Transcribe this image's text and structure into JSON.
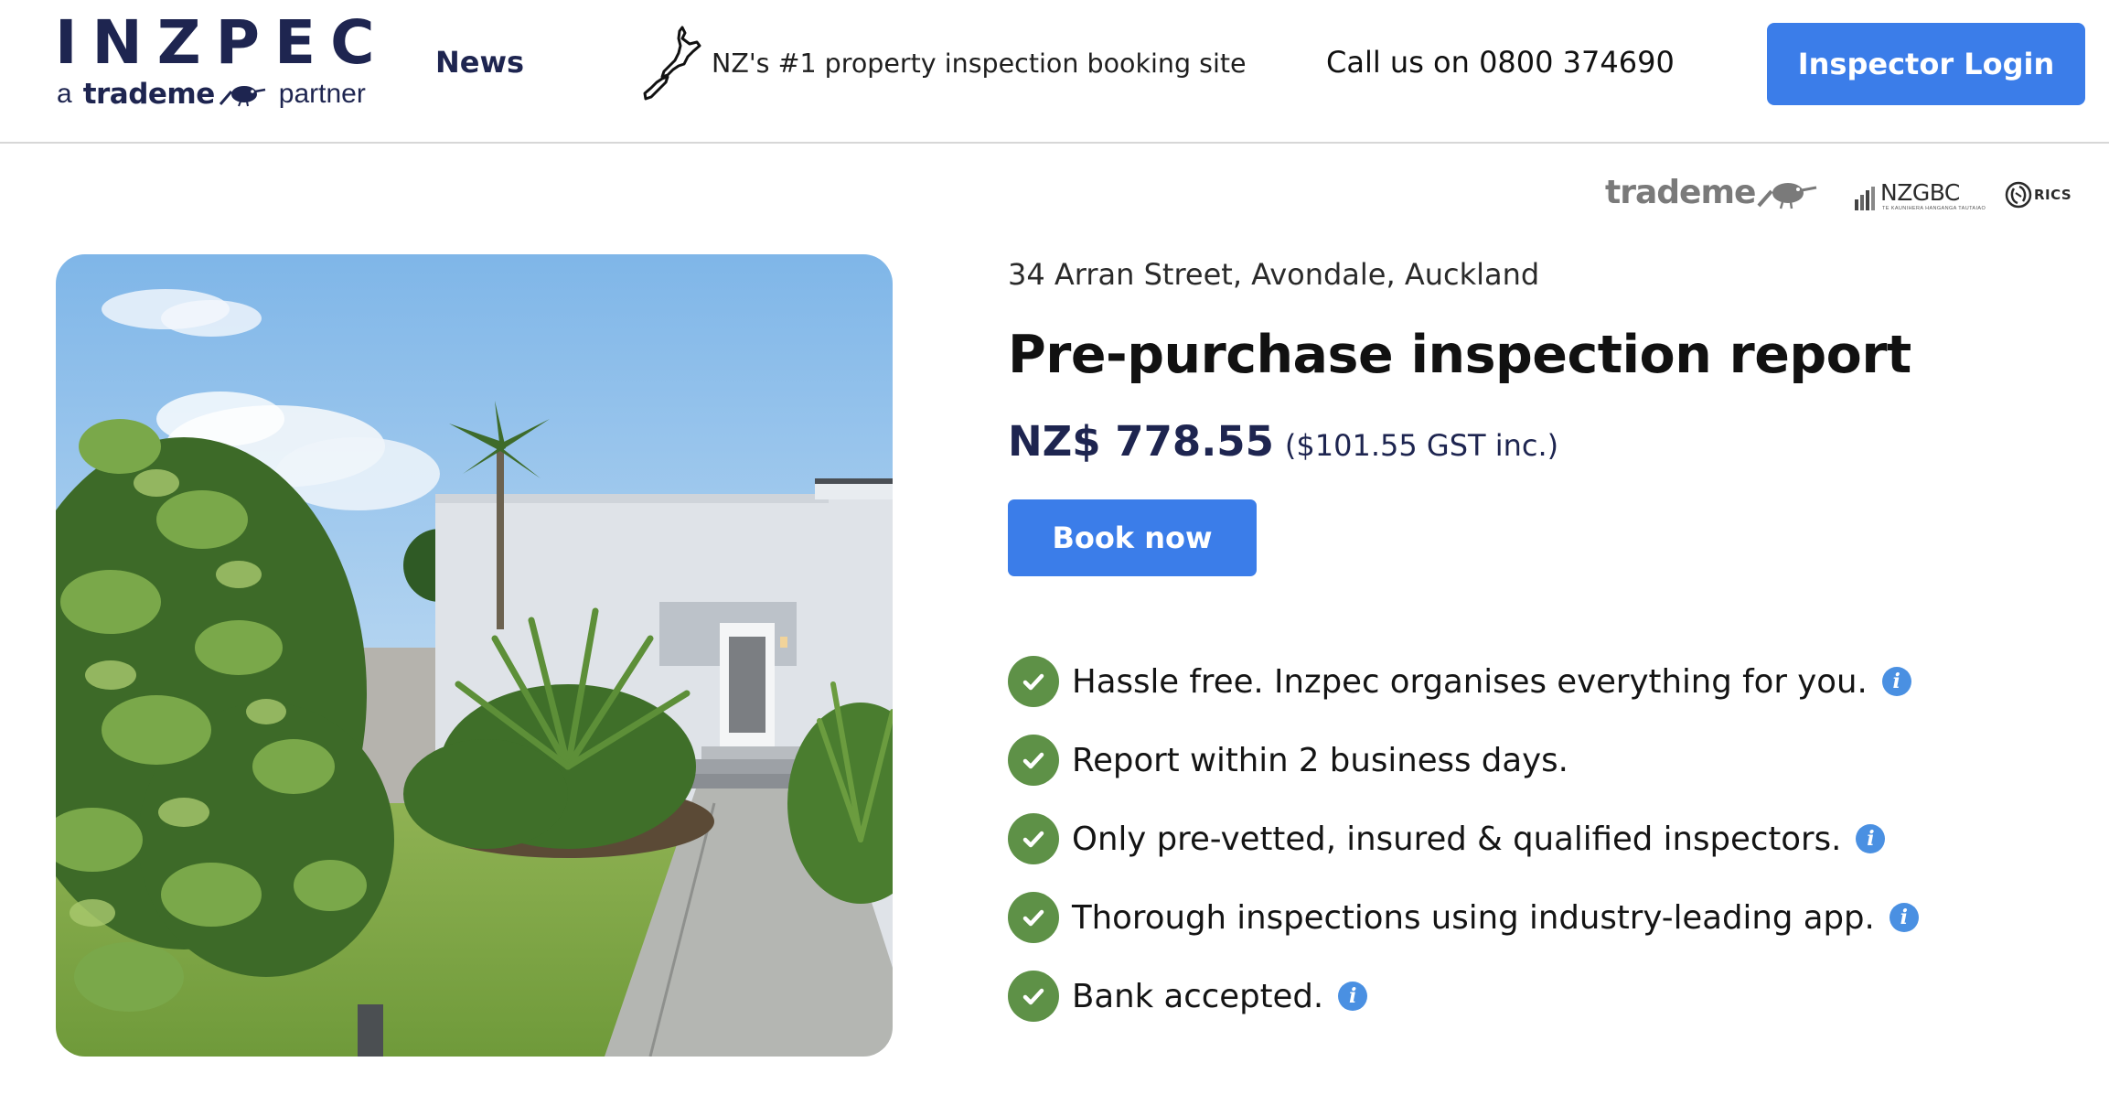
{
  "brand": {
    "logo_text": "INZPEC",
    "partner_prefix": "a",
    "partner_name": "trademe",
    "partner_suffix": "partner"
  },
  "nav": {
    "news_label": "News",
    "tagline": "NZ's #1 property inspection booking site",
    "phone": "Call us on 0800 374690",
    "login_label": "Inspector Login"
  },
  "partners": {
    "trademe": "trademe",
    "nzgbc": "NZGBC",
    "nzgbc_sub": "TE KAUNIHERA HANGANGA TAUTAIAO",
    "rics": "RICS"
  },
  "listing": {
    "address": "34 Arran Street, Avondale, Auckland",
    "title": "Pre-purchase inspection report",
    "price": "NZ$ 778.55",
    "gst_note": "($101.55 GST inc.)",
    "book_label": "Book now",
    "features": [
      {
        "text": "Hassle free. Inzpec organises everything for you.",
        "has_info": true
      },
      {
        "text": "Report within 2 business days.",
        "has_info": false
      },
      {
        "text": "Only pre-vetted, insured & qualified inspectors.",
        "has_info": true
      },
      {
        "text": "Thorough inspections using industry-leading app.",
        "has_info": true
      },
      {
        "text": "Bank accepted.",
        "has_info": true
      }
    ]
  },
  "icons": {
    "check": "check-circle-icon",
    "info": "info-icon",
    "info_glyph": "i",
    "nz_map": "nz-map-icon",
    "kiwi": "kiwi-bird-icon"
  },
  "colors": {
    "brand_navy": "#1e2550",
    "button_blue": "#3b7de9",
    "check_green": "#5e9147",
    "info_blue": "#4a90e2"
  }
}
